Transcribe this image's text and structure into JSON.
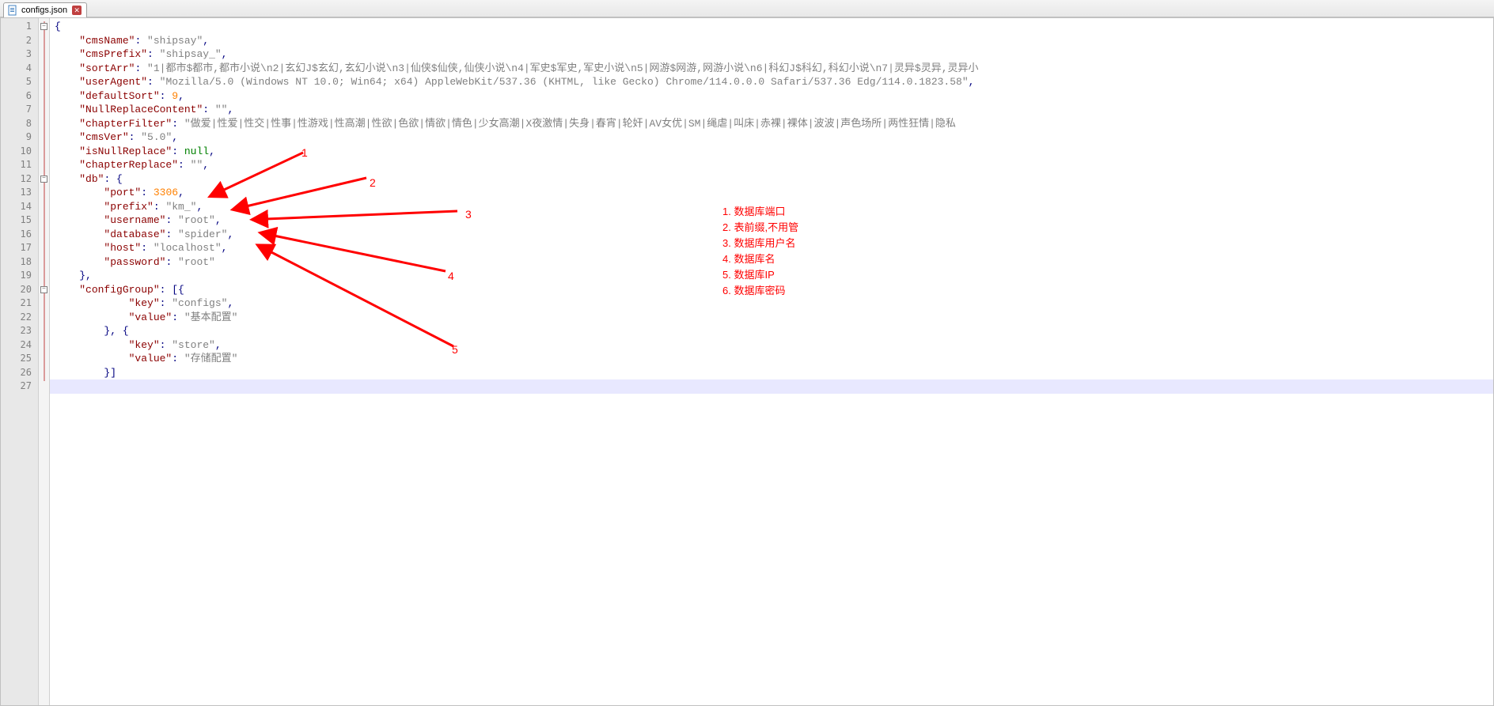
{
  "tab": {
    "filename": "configs.json"
  },
  "lines": {
    "count": 27
  },
  "code": {
    "l1": {
      "brace": "{"
    },
    "l2": {
      "key": "\"cmsName\"",
      "colon": ": ",
      "val": "\"shipsay\"",
      "comma": ","
    },
    "l3": {
      "key": "\"cmsPrefix\"",
      "colon": ": ",
      "val": "\"shipsay_\"",
      "comma": ","
    },
    "l4": {
      "key": "\"sortArr\"",
      "colon": ": ",
      "val": "\"1|都市$都市,都市小说\\n2|玄幻J$玄幻,玄幻小说\\n3|仙侠$仙侠,仙侠小说\\n4|军史$军史,军史小说\\n5|网游$网游,网游小说\\n6|科幻J$科幻,科幻小说\\n7|灵异$灵异,灵异小",
      "comma": ""
    },
    "l5": {
      "key": "\"userAgent\"",
      "colon": ": ",
      "val": "\"Mozilla/5.0 (Windows NT 10.0; Win64; x64) AppleWebKit/537.36 (KHTML, like Gecko) Chrome/114.0.0.0 Safari/537.36 Edg/114.0.1823.58\"",
      "comma": ","
    },
    "l6": {
      "key": "\"defaultSort\"",
      "colon": ": ",
      "val": "9",
      "comma": ","
    },
    "l7": {
      "key": "\"NullReplaceContent\"",
      "colon": ": ",
      "val": "\"\"",
      "comma": ","
    },
    "l8": {
      "key": "\"chapterFilter\"",
      "colon": ": ",
      "val": "\"做爱|性爱|性交|性事|性游戏|性高潮|性欲|色欲|情欲|情色|少女高潮|X夜激情|失身|春宵|轮奸|AV女优|SM|绳虐|叫床|赤裸|裸体|波波|声色场所|两性狂情|隐私",
      "comma": ""
    },
    "l9": {
      "key": "\"cmsVer\"",
      "colon": ": ",
      "val": "\"5.0\"",
      "comma": ","
    },
    "l10": {
      "key": "\"isNullReplace\"",
      "colon": ": ",
      "val": "null",
      "comma": ","
    },
    "l11": {
      "key": "\"chapterReplace\"",
      "colon": ": ",
      "val": "\"\"",
      "comma": ","
    },
    "l12": {
      "key": "\"db\"",
      "colon": ": ",
      "brace": "{"
    },
    "l13": {
      "key": "\"port\"",
      "colon": ": ",
      "val": "3306",
      "comma": ","
    },
    "l14": {
      "key": "\"prefix\"",
      "colon": ": ",
      "val": "\"km_\"",
      "comma": ","
    },
    "l15": {
      "key": "\"username\"",
      "colon": ": ",
      "val": "\"root\"",
      "comma": ","
    },
    "l16": {
      "key": "\"database\"",
      "colon": ": ",
      "val": "\"spider\"",
      "comma": ","
    },
    "l17": {
      "key": "\"host\"",
      "colon": ": ",
      "val": "\"localhost\"",
      "comma": ","
    },
    "l18": {
      "key": "\"password\"",
      "colon": ": ",
      "val": "\"root\"",
      "comma": ""
    },
    "l19": {
      "brace": "},",
      "comma": ""
    },
    "l20": {
      "key": "\"configGroup\"",
      "colon": ": ",
      "brace": "[{"
    },
    "l21": {
      "key": "\"key\"",
      "colon": ": ",
      "val": "\"configs\"",
      "comma": ","
    },
    "l22": {
      "key": "\"value\"",
      "colon": ": ",
      "val": "\"基本配置\"",
      "comma": ""
    },
    "l23": {
      "brace": "}, {"
    },
    "l24": {
      "key": "\"key\"",
      "colon": ": ",
      "val": "\"store\"",
      "comma": ","
    },
    "l25": {
      "key": "\"value\"",
      "colon": ": ",
      "val": "\"存储配置\"",
      "comma": ""
    },
    "l26": {
      "brace": "}]"
    }
  },
  "annotations": {
    "n1": "1",
    "n2": "2",
    "n3": "3",
    "n4": "4",
    "n5": "5",
    "legend1": "1. 数据库端口",
    "legend2": "2. 表前缀,不用管",
    "legend3": "3. 数据库用户名",
    "legend4": "4. 数据库名",
    "legend5": "5. 数据库IP",
    "legend6": "6. 数据库密码"
  }
}
